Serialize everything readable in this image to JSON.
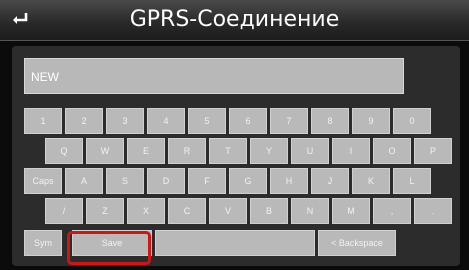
{
  "header": {
    "title": "GPRS-Соединение",
    "back_icon": "return-arrow-icon"
  },
  "input": {
    "value": "NEW"
  },
  "keyboard": {
    "row1": [
      "1",
      "2",
      "3",
      "4",
      "5",
      "6",
      "7",
      "8",
      "9",
      "0"
    ],
    "row2": [
      "Q",
      "W",
      "E",
      "R",
      "T",
      "Y",
      "U",
      "I",
      "O",
      "P"
    ],
    "row3": [
      "Caps",
      "A",
      "S",
      "D",
      "F",
      "G",
      "H",
      "J",
      "K",
      "L"
    ],
    "row4": [
      "/",
      "Z",
      "X",
      "C",
      "V",
      "B",
      "N",
      "M",
      ",",
      "."
    ],
    "row5": {
      "sym": "Sym",
      "save": "Save",
      "space": "",
      "backspace": "< Backspace"
    }
  },
  "colors": {
    "highlight": "#d41414",
    "key": "#b9b9b9"
  }
}
